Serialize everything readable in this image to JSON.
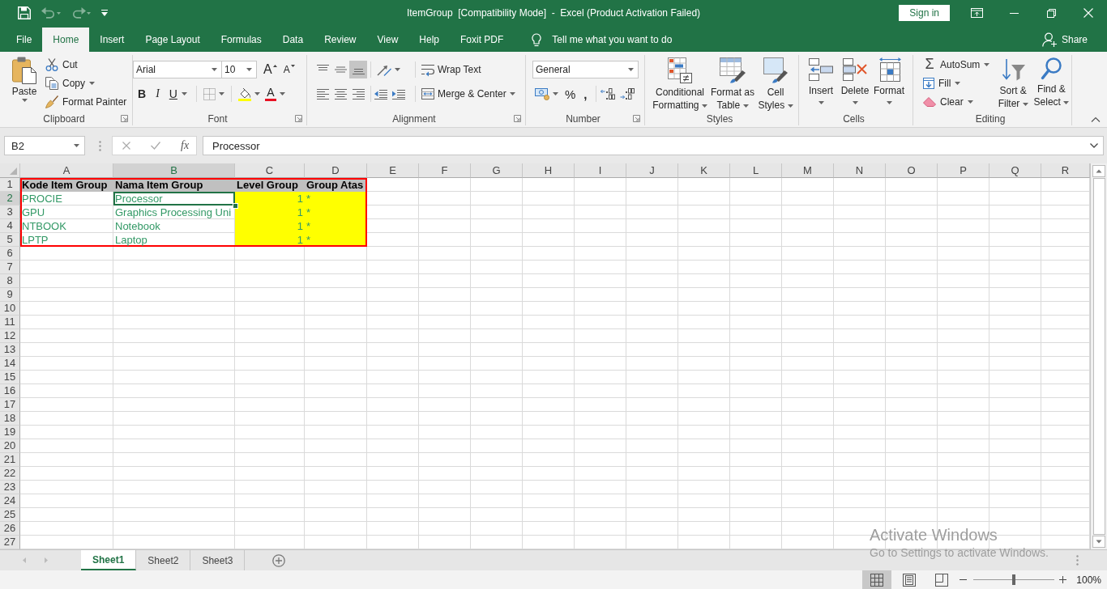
{
  "title_bar": {
    "quick_access": [
      {
        "kind": "save",
        "disabled": false
      },
      {
        "kind": "undo",
        "disabled": true
      },
      {
        "kind": "redo",
        "disabled": true
      },
      {
        "kind": "customize",
        "disabled": false
      }
    ],
    "title": "ItemGroup  [Compatibility Mode]  -  Excel (Product Activation Failed)",
    "sign_in": "Sign in"
  },
  "tabs": [
    {
      "label": "File",
      "selected": false
    },
    {
      "label": "Home",
      "selected": true
    },
    {
      "label": "Insert",
      "selected": false
    },
    {
      "label": "Page Layout",
      "selected": false
    },
    {
      "label": "Formulas",
      "selected": false
    },
    {
      "label": "Data",
      "selected": false
    },
    {
      "label": "Review",
      "selected": false
    },
    {
      "label": "View",
      "selected": false
    },
    {
      "label": "Help",
      "selected": false
    },
    {
      "label": "Foxit PDF",
      "selected": false
    }
  ],
  "tell_me": {
    "placeholder": "Tell me what you want to do"
  },
  "share": "Share",
  "ribbon": {
    "groups": [
      {
        "kind": "clipboard",
        "label": "Clipboard",
        "launcher": true,
        "paste": "Paste",
        "items": [
          {
            "kind": "cut",
            "label": "Cut",
            "menu": false
          },
          {
            "kind": "copy",
            "label": "Copy",
            "menu": true
          },
          {
            "kind": "painter",
            "label": "Format Painter",
            "menu": false
          }
        ]
      },
      {
        "kind": "font",
        "label": "Font",
        "launcher": true,
        "font_name": "Arial",
        "font_size": "10",
        "size_buttons": [
          {
            "kind": "grow",
            "label": "A"
          },
          {
            "kind": "shrink",
            "label": "A"
          }
        ],
        "styles": [
          {
            "kind": "bold",
            "label": "B",
            "menu": false
          },
          {
            "kind": "italic",
            "label": "I",
            "menu": false
          },
          {
            "kind": "underline",
            "label": "U",
            "menu": true
          }
        ],
        "font_color": "A"
      },
      {
        "kind": "alignment",
        "label": "Alignment",
        "launcher": true,
        "vertical": [
          {
            "kind": "top",
            "selected": false
          },
          {
            "kind": "middle",
            "selected": false
          },
          {
            "kind": "bottom",
            "selected": true
          }
        ],
        "horizontal": [
          {
            "kind": "left",
            "selected": false
          },
          {
            "kind": "center",
            "selected": false
          },
          {
            "kind": "right",
            "selected": false
          }
        ],
        "wrap_text": "Wrap Text",
        "merge": "Merge & Center"
      },
      {
        "kind": "number",
        "label": "Number",
        "launcher": true,
        "format": "General",
        "symbols": [
          {
            "kind": "percent",
            "label": "%"
          },
          {
            "kind": "comma",
            "label": ","
          }
        ]
      },
      {
        "kind": "styles",
        "label": "Styles",
        "buttons": [
          {
            "kind": "conditional",
            "label": "Conditional Formatting"
          },
          {
            "kind": "table",
            "label": "Format as Table"
          },
          {
            "kind": "cell",
            "label": "Cell Styles"
          }
        ]
      },
      {
        "kind": "cells",
        "label": "Cells",
        "buttons": [
          {
            "kind": "insert",
            "label": "Insert"
          },
          {
            "kind": "delete",
            "label": "Delete"
          },
          {
            "kind": "format",
            "label": "Format"
          }
        ]
      },
      {
        "kind": "editing",
        "label": "Editing",
        "autosum": {
          "symbol": "Σ",
          "label": "AutoSum"
        },
        "items": [
          {
            "kind": "fill",
            "label": "Fill"
          },
          {
            "kind": "clear",
            "label": "Clear"
          }
        ],
        "buttons": [
          {
            "kind": "sort",
            "label": "Sort & Filter"
          },
          {
            "kind": "find",
            "label": "Find & Select"
          }
        ]
      }
    ]
  },
  "formula_bar": {
    "name_box": "B2",
    "function_symbol": "fx",
    "formula": "Processor"
  },
  "sheet": {
    "outlined": true,
    "columns": [
      {
        "label": "A",
        "selected": false
      },
      {
        "label": "B",
        "selected": true
      },
      {
        "label": "C",
        "selected": false
      },
      {
        "label": "D",
        "selected": false
      },
      {
        "label": "E",
        "selected": false
      },
      {
        "label": "F",
        "selected": false
      },
      {
        "label": "G",
        "selected": false
      },
      {
        "label": "H",
        "selected": false
      },
      {
        "label": "I",
        "selected": false
      },
      {
        "label": "J",
        "selected": false
      },
      {
        "label": "K",
        "selected": false
      },
      {
        "label": "L",
        "selected": false
      },
      {
        "label": "M",
        "selected": false
      },
      {
        "label": "N",
        "selected": false
      },
      {
        "label": "O",
        "selected": false
      },
      {
        "label": "P",
        "selected": false
      },
      {
        "label": "Q",
        "selected": false
      },
      {
        "label": "R",
        "selected": false
      }
    ],
    "rows": [
      {
        "number": "1",
        "selected": false,
        "cells": [
          {
            "kind": "header",
            "text": "Kode Item Group",
            "selected": false,
            "fill": false
          },
          {
            "kind": "header",
            "text": "Nama Item Group",
            "selected": false,
            "fill": false
          },
          {
            "kind": "header",
            "text": "Level Group",
            "selected": false,
            "fill": false
          },
          {
            "kind": "header",
            "text": "Group Atas",
            "selected": false,
            "fill": false
          }
        ]
      },
      {
        "number": "2",
        "selected": true,
        "cells": [
          {
            "kind": "text",
            "text": "PROCIE",
            "selected": false,
            "fill": false
          },
          {
            "kind": "text",
            "text": "Processor",
            "selected": true,
            "fill": false
          },
          {
            "kind": "number",
            "text": "1",
            "selected": false,
            "fill": true
          },
          {
            "kind": "text",
            "text": "*",
            "selected": false,
            "fill": true
          }
        ]
      },
      {
        "number": "3",
        "selected": false,
        "cells": [
          {
            "kind": "text",
            "text": "GPU",
            "selected": false,
            "fill": false
          },
          {
            "kind": "text",
            "text": "Graphics Processing Uni",
            "selected": false,
            "fill": false
          },
          {
            "kind": "number",
            "text": "1",
            "selected": false,
            "fill": true
          },
          {
            "kind": "text",
            "text": "*",
            "selected": false,
            "fill": true
          }
        ]
      },
      {
        "number": "4",
        "selected": false,
        "cells": [
          {
            "kind": "text",
            "text": "NTBOOK",
            "selected": false,
            "fill": false
          },
          {
            "kind": "text",
            "text": "Notebook",
            "selected": false,
            "fill": false
          },
          {
            "kind": "number",
            "text": "1",
            "selected": false,
            "fill": true
          },
          {
            "kind": "text",
            "text": "*",
            "selected": false,
            "fill": true
          }
        ]
      },
      {
        "number": "5",
        "selected": false,
        "cells": [
          {
            "kind": "text",
            "text": "LPTP",
            "selected": false,
            "fill": false
          },
          {
            "kind": "text",
            "text": "Laptop",
            "selected": false,
            "fill": false
          },
          {
            "kind": "number",
            "text": "1",
            "selected": false,
            "fill": true
          },
          {
            "kind": "text",
            "text": "*",
            "selected": false,
            "fill": true
          }
        ]
      },
      {
        "number": "6",
        "selected": false
      },
      {
        "number": "7",
        "selected": false
      },
      {
        "number": "8",
        "selected": false
      },
      {
        "number": "9",
        "selected": false
      },
      {
        "number": "10",
        "selected": false
      },
      {
        "number": "11",
        "selected": false
      },
      {
        "number": "12",
        "selected": false
      },
      {
        "number": "13",
        "selected": false
      },
      {
        "number": "14",
        "selected": false
      },
      {
        "number": "15",
        "selected": false
      },
      {
        "number": "16",
        "selected": false
      },
      {
        "number": "17",
        "selected": false
      },
      {
        "number": "18",
        "selected": false
      },
      {
        "number": "19",
        "selected": false
      },
      {
        "number": "20",
        "selected": false
      },
      {
        "number": "21",
        "selected": false
      },
      {
        "number": "22",
        "selected": false
      },
      {
        "number": "23",
        "selected": false
      },
      {
        "number": "24",
        "selected": false
      },
      {
        "number": "25",
        "selected": false
      },
      {
        "number": "26",
        "selected": false
      },
      {
        "number": "27",
        "selected": false
      }
    ]
  },
  "sheet_tabs": [
    {
      "label": "Sheet1",
      "selected": true
    },
    {
      "label": "Sheet2",
      "selected": false
    },
    {
      "label": "Sheet3",
      "selected": false
    }
  ],
  "status_bar": {
    "views": [
      {
        "kind": "normal",
        "selected": true
      },
      {
        "kind": "page_layout",
        "selected": false
      },
      {
        "kind": "page_break",
        "selected": false
      }
    ],
    "zoom": {
      "level": 0.5,
      "reading": "100%"
    }
  },
  "activation_notice": {
    "title": "Activate Windows",
    "message": "Go to Settings to activate Windows."
  }
}
